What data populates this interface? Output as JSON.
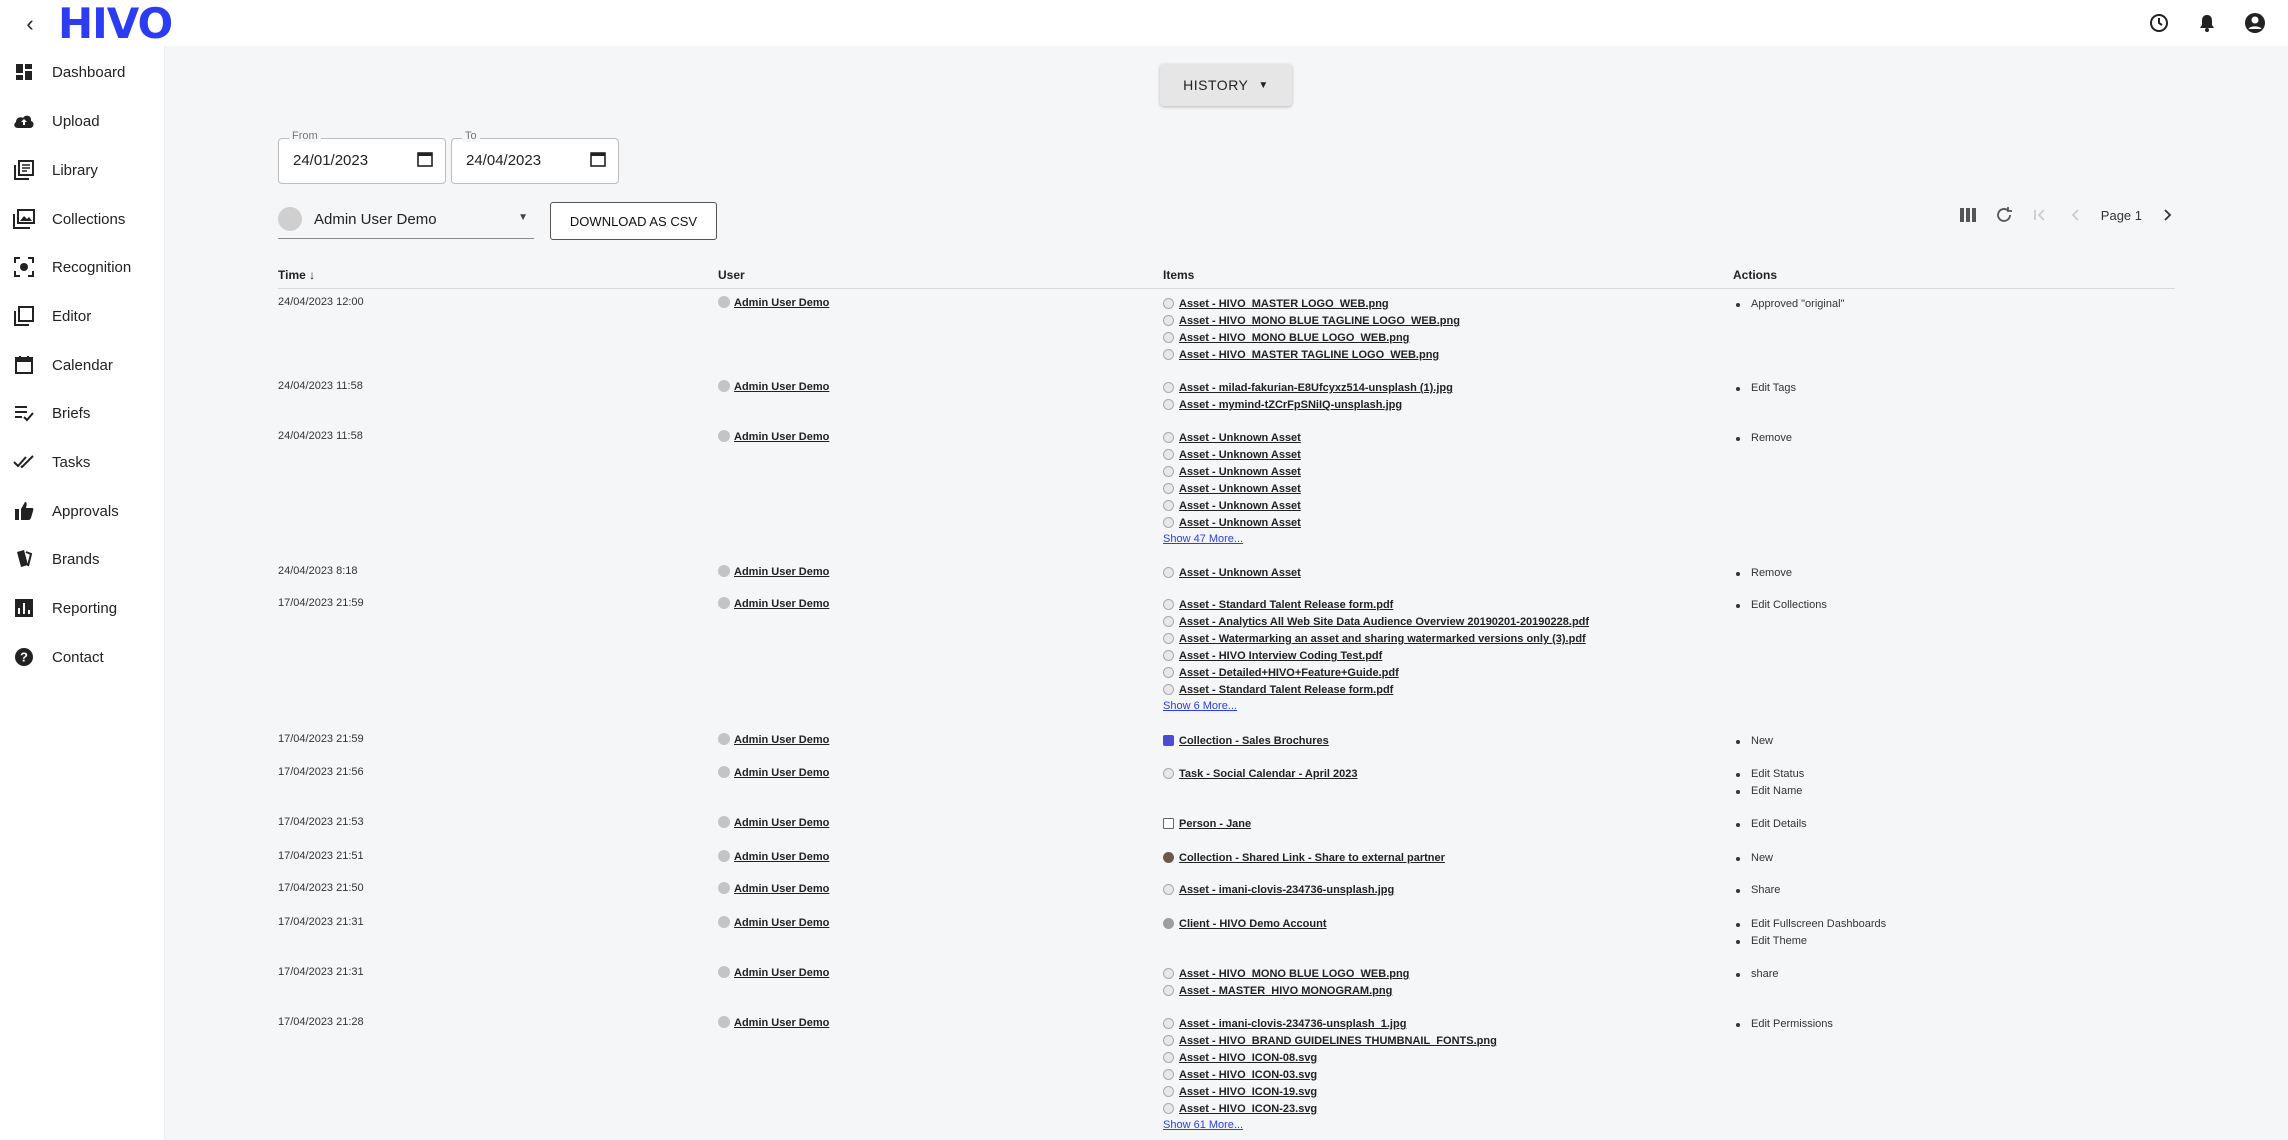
{
  "app": {
    "logo": "HIVO"
  },
  "sidebar": {
    "items": [
      {
        "label": "Dashboard",
        "icon": "dashboard-icon"
      },
      {
        "label": "Upload",
        "icon": "cloud-upload-icon"
      },
      {
        "label": "Library",
        "icon": "library-icon"
      },
      {
        "label": "Collections",
        "icon": "collections-icon"
      },
      {
        "label": "Recognition",
        "icon": "recognition-icon"
      },
      {
        "label": "Editor",
        "icon": "editor-icon"
      },
      {
        "label": "Calendar",
        "icon": "calendar-icon"
      },
      {
        "label": "Briefs",
        "icon": "briefs-icon"
      },
      {
        "label": "Tasks",
        "icon": "tasks-icon"
      },
      {
        "label": "Approvals",
        "icon": "thumbs-up-icon"
      },
      {
        "label": "Brands",
        "icon": "brands-icon"
      },
      {
        "label": "Reporting",
        "icon": "reporting-icon"
      },
      {
        "label": "Contact",
        "icon": "help-icon"
      }
    ]
  },
  "main": {
    "history_button": "HISTORY",
    "from": {
      "label": "From",
      "value": "24/01/2023"
    },
    "to": {
      "label": "To",
      "value": "24/04/2023"
    },
    "user_filter": "Admin User Demo",
    "csv_button": "DOWNLOAD AS CSV",
    "page_label": "Page 1"
  },
  "table": {
    "headers": {
      "time": "Time ↓",
      "user": "User",
      "items": "Items",
      "actions": "Actions"
    },
    "rows": [
      {
        "time": "24/04/2023 12:00",
        "user": "Admin User Demo",
        "items": [
          {
            "text": "Asset - HIVO_MASTER LOGO_WEB.png",
            "kind": "asset"
          },
          {
            "text": "Asset - HIVO_MONO BLUE TAGLINE LOGO_WEB.png",
            "kind": "asset"
          },
          {
            "text": "Asset - HIVO_MONO BLUE LOGO_WEB.png",
            "kind": "asset"
          },
          {
            "text": "Asset - HIVO_MASTER TAGLINE LOGO_WEB.png",
            "kind": "asset"
          }
        ],
        "more": "",
        "actions": [
          "Approved \"original\""
        ]
      },
      {
        "time": "24/04/2023 11:58",
        "user": "Admin User Demo",
        "items": [
          {
            "text": "Asset - milad-fakurian-E8Ufcyxz514-unsplash (1).jpg",
            "kind": "asset"
          },
          {
            "text": "Asset - mymind-tZCrFpSNiIQ-unsplash.jpg",
            "kind": "asset"
          }
        ],
        "more": "",
        "actions": [
          "Edit Tags"
        ]
      },
      {
        "time": "24/04/2023 11:58",
        "user": "Admin User Demo",
        "items": [
          {
            "text": "Asset - Unknown Asset",
            "kind": "asset"
          },
          {
            "text": "Asset - Unknown Asset",
            "kind": "asset"
          },
          {
            "text": "Asset - Unknown Asset",
            "kind": "asset"
          },
          {
            "text": "Asset - Unknown Asset",
            "kind": "asset"
          },
          {
            "text": "Asset - Unknown Asset",
            "kind": "asset"
          },
          {
            "text": "Asset - Unknown Asset",
            "kind": "asset"
          }
        ],
        "more": "Show 47 More...",
        "actions": [
          "Remove"
        ]
      },
      {
        "time": "24/04/2023 8:18",
        "user": "Admin User Demo",
        "items": [
          {
            "text": "Asset - Unknown Asset",
            "kind": "asset"
          }
        ],
        "more": "",
        "actions": [
          "Remove"
        ]
      },
      {
        "time": "17/04/2023 21:59",
        "user": "Admin User Demo",
        "items": [
          {
            "text": "Asset - Standard Talent Release form.pdf",
            "kind": "asset"
          },
          {
            "text": "Asset - Analytics All Web Site Data Audience Overview 20190201-20190228.pdf",
            "kind": "asset"
          },
          {
            "text": "Asset - Watermarking an asset and sharing watermarked versions only (3).pdf",
            "kind": "asset"
          },
          {
            "text": "Asset - HIVO Interview Coding Test.pdf",
            "kind": "asset"
          },
          {
            "text": "Asset - Detailed+HIVO+Feature+Guide.pdf",
            "kind": "asset"
          },
          {
            "text": "Asset - Standard Talent Release form.pdf",
            "kind": "asset"
          }
        ],
        "more": "Show 6 More...",
        "actions": [
          "Edit Collections"
        ]
      },
      {
        "time": "17/04/2023 21:59",
        "user": "Admin User Demo",
        "items": [
          {
            "text": "Collection - Sales Brochures",
            "kind": "collection"
          }
        ],
        "more": "",
        "actions": [
          "New"
        ]
      },
      {
        "time": "17/04/2023 21:56",
        "user": "Admin User Demo",
        "items": [
          {
            "text": "Task - Social Calendar - April 2023",
            "kind": "asset"
          }
        ],
        "more": "",
        "actions": [
          "Edit Status",
          "Edit Name"
        ]
      },
      {
        "time": "17/04/2023 21:53",
        "user": "Admin User Demo",
        "items": [
          {
            "text": "Person - Jane",
            "kind": "person"
          }
        ],
        "more": "",
        "actions": [
          "Edit Details"
        ]
      },
      {
        "time": "17/04/2023 21:51",
        "user": "Admin User Demo",
        "items": [
          {
            "text": "Collection - Shared Link - Share to external partner",
            "kind": "shared"
          }
        ],
        "more": "",
        "actions": [
          "New"
        ]
      },
      {
        "time": "17/04/2023 21:50",
        "user": "Admin User Demo",
        "items": [
          {
            "text": "Asset - imani-clovis-234736-unsplash.jpg",
            "kind": "asset"
          }
        ],
        "more": "",
        "actions": [
          "Share"
        ]
      },
      {
        "time": "17/04/2023 21:31",
        "user": "Admin User Demo",
        "items": [
          {
            "text": "Client - HIVO Demo Account",
            "kind": "client"
          }
        ],
        "more": "",
        "actions": [
          "Edit Fullscreen Dashboards",
          "Edit Theme"
        ]
      },
      {
        "time": "17/04/2023 21:31",
        "user": "Admin User Demo",
        "items": [
          {
            "text": "Asset - HIVO_MONO BLUE LOGO_WEB.png",
            "kind": "asset"
          },
          {
            "text": "Asset - MASTER_HIVO MONOGRAM.png",
            "kind": "asset"
          }
        ],
        "more": "",
        "actions": [
          "share"
        ]
      },
      {
        "time": "17/04/2023 21:28",
        "user": "Admin User Demo",
        "items": [
          {
            "text": "Asset - imani-clovis-234736-unsplash_1.jpg",
            "kind": "asset"
          },
          {
            "text": "Asset - HIVO_BRAND GUIDELINES THUMBNAIL_FONTS.png",
            "kind": "asset"
          },
          {
            "text": "Asset - HIVO_ICON-08.svg",
            "kind": "asset"
          },
          {
            "text": "Asset - HIVO_ICON-03.svg",
            "kind": "asset"
          },
          {
            "text": "Asset - HIVO_ICON-19.svg",
            "kind": "asset"
          },
          {
            "text": "Asset - HIVO_ICON-23.svg",
            "kind": "asset"
          }
        ],
        "more": "Show 61 More...",
        "actions": [
          "Edit Permissions"
        ]
      }
    ]
  }
}
